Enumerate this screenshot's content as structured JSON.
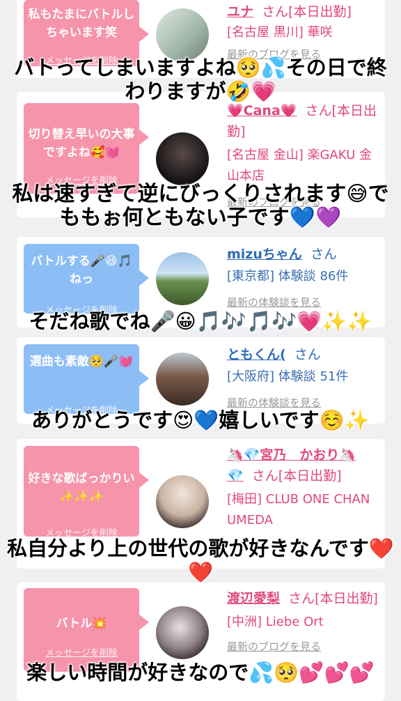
{
  "entries": [
    {
      "message": "私もたまにバトルしちゃいます笑",
      "delete_label": "メッセージを削除",
      "name": "ユナ",
      "honorific": "さん[本日出勤]",
      "shop_line": "[名古屋 黒川] 華咲",
      "link": "最新のブログを見る",
      "caption": "バトってしまいますよね🥺💦その日で終わりますが🤣💗"
    },
    {
      "message": "切り替え早いの大事ですよね🥰💓",
      "delete_label": "メッセージを削除",
      "name": "💗Cana💗",
      "honorific": "さん[本日出勤]",
      "shop_line": "[名古屋 金山] 楽GAKU 金山本店",
      "link": "最新のブログを見る",
      "caption": "私は速すぎて逆にびっくりされます😅でももぉ何ともない子です💙💜"
    },
    {
      "message": "バトルする🎤😆🎵ねっ",
      "delete_label": "メッセージを削除",
      "name": "mizuちゃん",
      "honorific": "さん",
      "shop_line": "[東京都] 体験談 86件",
      "link": "最新の体験談を見る",
      "caption": "そだね歌でね🎤😀🎵🎶🎵🎶💗✨✨"
    },
    {
      "message": "選曲も素敵🥺🎤💓",
      "delete_label": "メッセージを削除",
      "name": "ともくん(",
      "honorific": "さん",
      "shop_line": "[大阪府] 体験談 51件",
      "link": "最新の体験談を見る",
      "caption": "ありがとうです😍💙嬉しいです☺️✨"
    },
    {
      "message": "好きな歌ばっかりい✨✨✨",
      "delete_label": "メッセージを削除",
      "name": "🦄💎宮乃　かおり🦄💎",
      "honorific": "さん[本日出勤]",
      "shop_line": "[梅田] CLUB ONE CHAN UMEDA",
      "link": "",
      "caption": "私自分より上の世代の歌が好きなんです❤️❤️"
    },
    {
      "message": "バトル💥",
      "delete_label": "メッセージを削除",
      "name": "渡辺愛梨",
      "honorific": "さん[本日出勤]",
      "shop_line": "[中洲] Liebe Ort",
      "link": "最新のブログを見る",
      "caption": "楽しい時間が好きなので💦🥺💕💕💕"
    }
  ]
}
